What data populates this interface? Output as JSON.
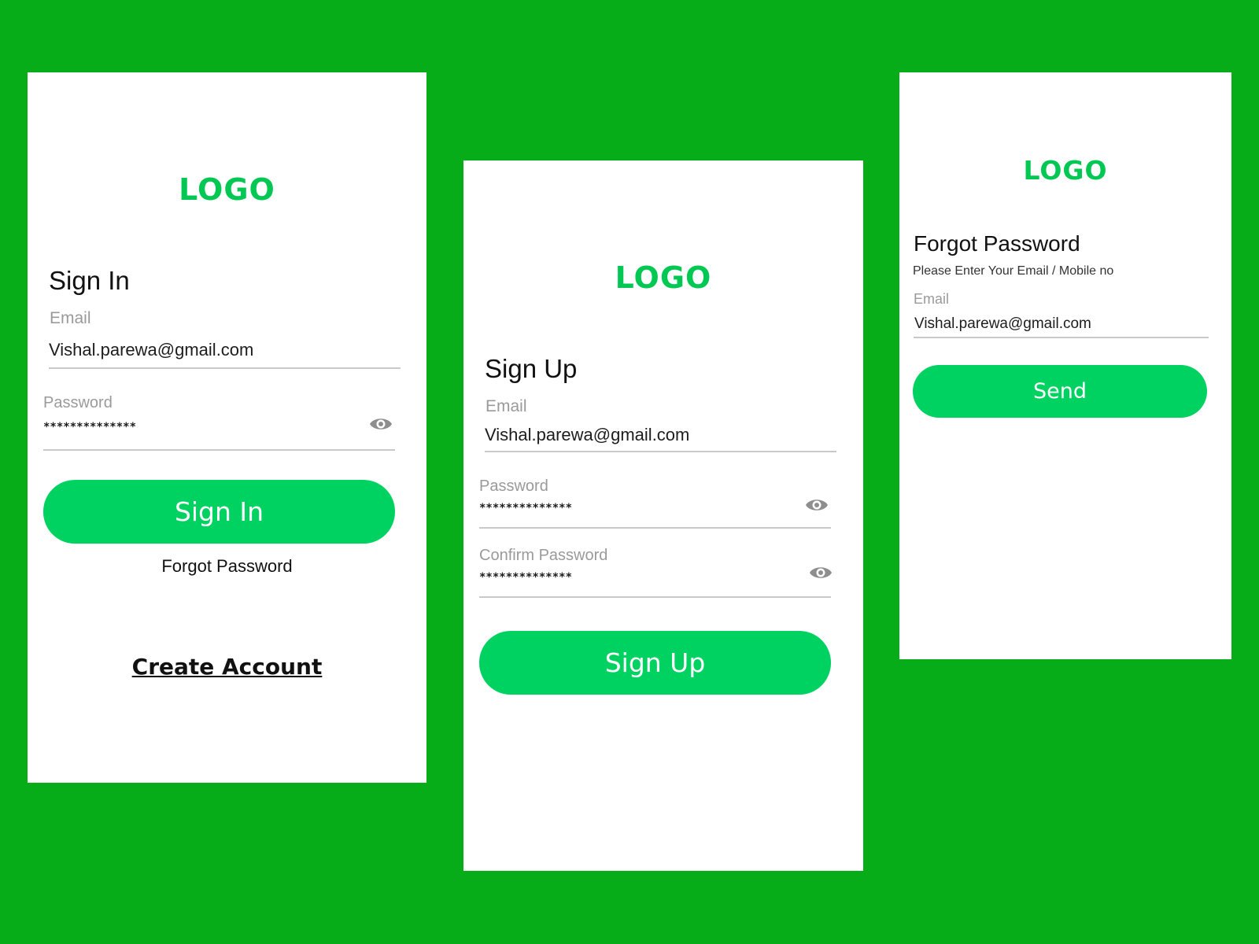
{
  "signin": {
    "logo": "LOGO",
    "title": "Sign In",
    "email_label": "Email",
    "email_value": "Vishal.parewa@gmail.com",
    "password_label": "Password",
    "password_value": "**************",
    "button_label": "Sign In",
    "forgot_link": "Forgot Password",
    "create_account_link": "Create Account"
  },
  "signup": {
    "logo": "LOGO",
    "title": "Sign Up",
    "email_label": "Email",
    "email_value": "Vishal.parewa@gmail.com",
    "password_label": "Password",
    "password_value": "**************",
    "confirm_label": "Confirm Password",
    "confirm_value": "**************",
    "button_label": "Sign Up"
  },
  "forgot": {
    "logo": "LOGO",
    "title": "Forgot Password",
    "subtitle": "Please Enter Your Email / Mobile no",
    "email_label": "Email",
    "email_value": "Vishal.parewa@gmail.com",
    "button_label": "Send"
  },
  "icons": {
    "password_toggle": "eye-icon"
  },
  "colors": {
    "background": "#06ad19",
    "brand": "#00d261",
    "logo": "#00c853",
    "card": "#ffffff"
  }
}
